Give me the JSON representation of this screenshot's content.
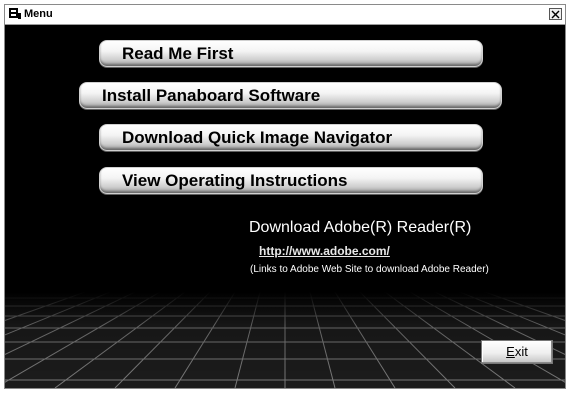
{
  "window": {
    "title": "Menu",
    "close_glyph": "×"
  },
  "menu": {
    "buttons": [
      {
        "label": "Read Me First"
      },
      {
        "label": "Install Panaboard Software"
      },
      {
        "label": "Download Quick Image Navigator"
      },
      {
        "label": "View Operating Instructions"
      }
    ]
  },
  "adobe": {
    "heading": "Download Adobe(R) Reader(R)",
    "link": "http://www.adobe.com/",
    "note": "(Links to Adobe Web Site to download Adobe Reader)"
  },
  "footer": {
    "exit_mnemonic": "E",
    "exit_rest": "xit"
  },
  "colors": {
    "background": "#000000",
    "button_face": "#f4f4f4",
    "text_light": "#ffffff"
  },
  "icons": [
    "app-menu-icon",
    "close-icon"
  ]
}
